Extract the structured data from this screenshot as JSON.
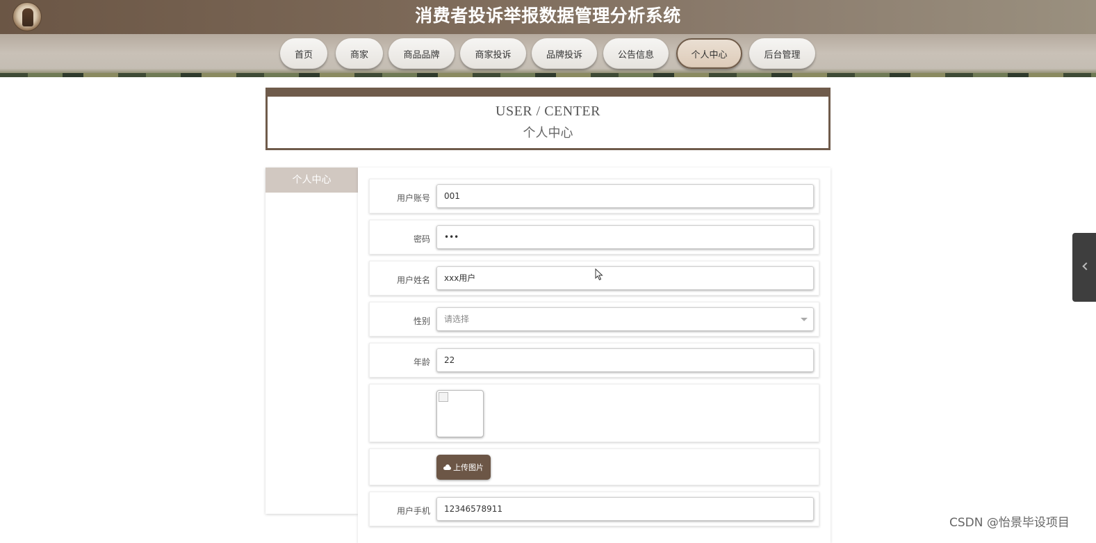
{
  "header": {
    "title": "消费者投诉举报数据管理分析系统",
    "logo_icon": "logo-emblem-icon"
  },
  "nav": {
    "items": [
      {
        "label": "首页",
        "active": false
      },
      {
        "label": "商家",
        "active": false
      },
      {
        "label": "商品品牌",
        "active": false
      },
      {
        "label": "商家投诉",
        "active": false
      },
      {
        "label": "品牌投诉",
        "active": false
      },
      {
        "label": "公告信息",
        "active": false
      },
      {
        "label": "个人中心",
        "active": true
      },
      {
        "label": "后台管理",
        "active": false
      }
    ]
  },
  "banner": {
    "title_en": "USER / CENTER",
    "title_cn": "个人中心"
  },
  "sidebar": {
    "items": [
      {
        "label": "个人中心"
      }
    ]
  },
  "form": {
    "account": {
      "label": "用户账号",
      "value": "001"
    },
    "password": {
      "label": "密码",
      "value": "•••"
    },
    "name": {
      "label": "用户姓名",
      "value": "xxx用户"
    },
    "gender": {
      "label": "性别",
      "placeholder": "请选择"
    },
    "age": {
      "label": "年龄",
      "value": "22"
    },
    "upload": {
      "label": "上传图片",
      "icon": "cloud-upload-icon"
    },
    "phone": {
      "label": "用户手机",
      "value": "12346578911"
    }
  },
  "watermark": "CSDN @怡景毕设项目",
  "colors": {
    "accent": "#6c5646",
    "header_bg": "#7d6a59",
    "sidebar_active": "#d1c8c1"
  }
}
